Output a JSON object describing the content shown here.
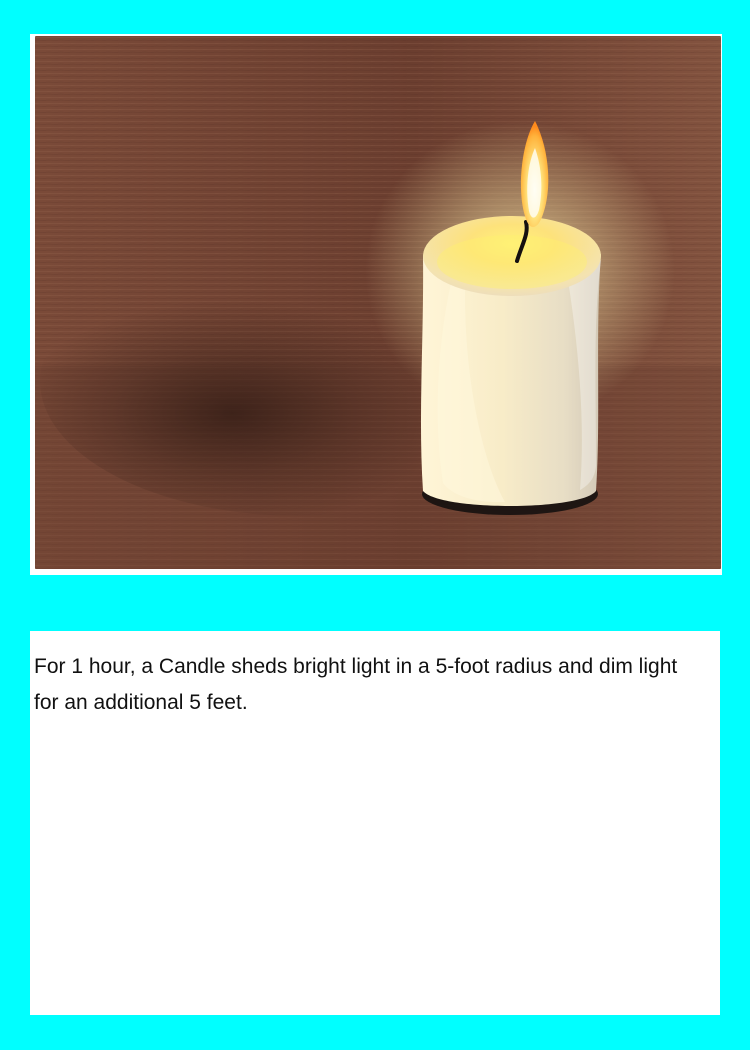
{
  "card": {
    "description": "For 1 hour, a Candle sheds bright light in a 5-foot radius and dim light for an additional 5 feet."
  },
  "colors": {
    "background": "#00ffff",
    "panel": "#ffffff",
    "wood_dark": "#5a3427",
    "wood_light": "#8b5a43",
    "candle_wax": "#f7efcf",
    "flame": "#ffd35a"
  },
  "illustration": {
    "subject": "lit-pillar-candle"
  }
}
